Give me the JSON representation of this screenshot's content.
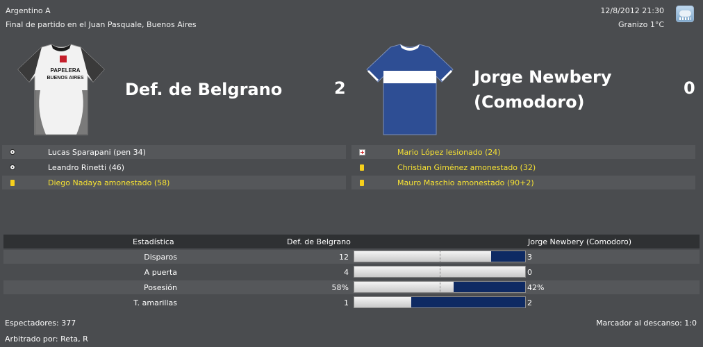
{
  "header": {
    "competition": "Argentino A",
    "venue": "Final de partido en el Juan Pasquale, Buenos Aires",
    "datetime": "12/8/2012 21:30",
    "weather": "Granizo 1°C",
    "weather_icon": "hail-cloud-icon"
  },
  "home": {
    "name": "Def. de Belgrano",
    "score": "2",
    "shirt_sponsor_line1": "PAPELERA",
    "shirt_sponsor_line2": "BUENOS AIRES",
    "shirt_colors": {
      "body": "#f2f2f2",
      "accent": "#c41e2a",
      "trim": "#1a1a1a"
    },
    "events": [
      {
        "icon": "goal-ball-icon",
        "text": "Lucas Sparapani (pen 34)",
        "highlight": false
      },
      {
        "icon": "goal-ball-icon",
        "text": "Leandro Rinetti (46)",
        "highlight": false
      },
      {
        "icon": "yellow-card-icon",
        "text": "Diego Nadaya amonestado (58)",
        "highlight": true
      }
    ]
  },
  "away": {
    "name_line1": "Jorge Newbery",
    "name_line2": "(Comodoro)",
    "score": "0",
    "shirt_colors": {
      "body": "#2e4e94",
      "band": "#ffffff"
    },
    "events": [
      {
        "icon": "injury-icon",
        "text": "Mario López lesionado (24)",
        "highlight": true
      },
      {
        "icon": "yellow-card-icon",
        "text": "Christian Giménez amonestado (32)",
        "highlight": true
      },
      {
        "icon": "yellow-card-icon",
        "text": "Mauro Maschio amonestado (90+2)",
        "highlight": true
      }
    ]
  },
  "stats": {
    "header_label": "Estadística",
    "home_team": "Def. de Belgrano",
    "away_team": "Jorge Newbery (Comodoro)",
    "rows": [
      {
        "label": "Disparos",
        "home": "12",
        "away": "3",
        "away_share": 0.2
      },
      {
        "label": "A puerta",
        "home": "4",
        "away": "0",
        "away_share": 0.0
      },
      {
        "label": "Posesión",
        "home": "58%",
        "away": "42%",
        "away_share": 0.42
      },
      {
        "label": "T. amarillas",
        "home": "1",
        "away": "2",
        "away_share": 0.667
      }
    ],
    "colors": {
      "away_bar": "#0e2a63",
      "highlight_text": "#f7e233"
    }
  },
  "footer": {
    "spectators": "Espectadores: 377",
    "halftime": "Marcador al descanso: 1:0",
    "referee": "Arbitrado por: Reta, R"
  }
}
